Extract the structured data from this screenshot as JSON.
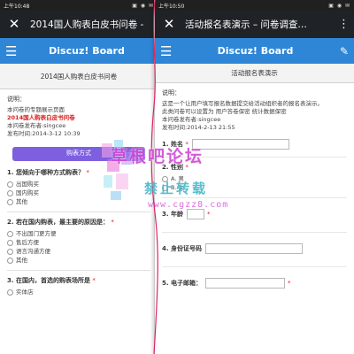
{
  "left": {
    "status_time": "上午10:48",
    "status_icons": "▣ ◉ ✉",
    "app_title": "2014国人购表白皮书问卷 -",
    "brand": "Discuz! Board",
    "form_title": "2014国人购表白皮书问卷",
    "desc_heading": "说明：",
    "desc_line1": "本问卷的专题展示页面",
    "desc_red": "2014国人购表白皮书问卷",
    "desc_publisher": "本问卷发布者:singcee",
    "desc_time": "发布时间:2014-3-12 10:39",
    "button_label": "购表方式",
    "q1": {
      "title": "1. 您倾向于哪种方式购表？",
      "req": "*",
      "options": [
        "出国购买",
        "国内购买",
        "其他"
      ]
    },
    "q2": {
      "title": "2. 若在国内购表，最主要的原因是：",
      "req": "*",
      "options": [
        "不出国门更方便",
        "售后方便",
        "语言沟通方便",
        "其他"
      ]
    },
    "q3": {
      "title": "3. 在国内，首选的购表场所是",
      "req": "*",
      "options": [
        "实体店"
      ]
    }
  },
  "right": {
    "status_time": "上午10:50",
    "status_icons": "▣ ◉ ✉",
    "app_title": "活动报名表演示 – 问卷调查…",
    "brand": "Discuz! Board",
    "form_title": "活动报名表演示",
    "desc_heading": "说明：",
    "desc_line1": "这是一个让用户填写报名数据提交给活动组织者的报名表演示。",
    "desc_line2": "此类问卷可以设置为 用户答卷保密  统计数据保密",
    "desc_publisher": "本问卷发布者:singcee",
    "desc_time": "发布时间:2014-2-13 21:55",
    "f1": {
      "label": "1. 姓名",
      "req": "*"
    },
    "f2": {
      "label": "2. 性别",
      "req": "*",
      "options": [
        "A. 男",
        "B. 女"
      ]
    },
    "f3": {
      "label": "3. 年龄",
      "req": "*"
    },
    "f4": {
      "label": "4. 身份证号码",
      "req": ""
    },
    "f5": {
      "label": "5. 电子邮箱：",
      "req": "*"
    }
  },
  "watermark": {
    "title": "草根吧论坛",
    "subtitle": "禁止转载",
    "url": "www.cgzz8.com"
  },
  "colors": {
    "appbar": "#1f2327",
    "header_blue": "#2f86d6",
    "button_purple": "#7d5fe0",
    "required_red": "#d81e1e"
  }
}
